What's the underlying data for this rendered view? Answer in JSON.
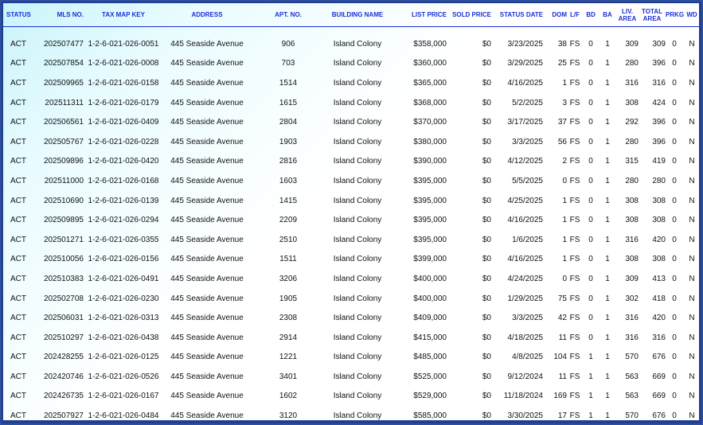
{
  "headers": {
    "status": "STATUS",
    "mls": "MLS NO.",
    "tmk": "TAX MAP KEY",
    "address": "ADDRESS",
    "apt": "APT. NO.",
    "building": "BUILDING NAME",
    "list_price": "LIST PRICE",
    "sold_price": "SOLD PRICE",
    "status_date": "STATUS DATE",
    "dom": "DOM",
    "lf": "L/F",
    "bd": "BD",
    "ba": "BA",
    "liv_area_1": "LIV.",
    "liv_area_2": "AREA",
    "total_area_1": "TOTAL",
    "total_area_2": "AREA",
    "prkg": "PRKG",
    "wd": "WD"
  },
  "rows": [
    {
      "status": "ACT",
      "mls": "202507477",
      "tmk": "1-2-6-021-026-0051",
      "address": "445 Seaside Avenue",
      "apt": "906",
      "building": "Island Colony",
      "list_price": "$358,000",
      "sold_price": "$0",
      "status_date": "3/23/2025",
      "dom": "38",
      "lf": "FS",
      "bd": "0",
      "ba": "1",
      "liv_area": "309",
      "total_area": "309",
      "prkg": "0",
      "wd": "N"
    },
    {
      "status": "ACT",
      "mls": "202507854",
      "tmk": "1-2-6-021-026-0008",
      "address": "445 Seaside Avenue",
      "apt": "703",
      "building": "Island Colony",
      "list_price": "$360,000",
      "sold_price": "$0",
      "status_date": "3/29/2025",
      "dom": "25",
      "lf": "FS",
      "bd": "0",
      "ba": "1",
      "liv_area": "280",
      "total_area": "396",
      "prkg": "0",
      "wd": "N"
    },
    {
      "status": "ACT",
      "mls": "202509965",
      "tmk": "1-2-6-021-026-0158",
      "address": "445 Seaside Avenue",
      "apt": "1514",
      "building": "Island Colony",
      "list_price": "$365,000",
      "sold_price": "$0",
      "status_date": "4/16/2025",
      "dom": "1",
      "lf": "FS",
      "bd": "0",
      "ba": "1",
      "liv_area": "316",
      "total_area": "316",
      "prkg": "0",
      "wd": "N"
    },
    {
      "status": "ACT",
      "mls": "202511311",
      "tmk": "1-2-6-021-026-0179",
      "address": "445 Seaside Avenue",
      "apt": "1615",
      "building": "Island Colony",
      "list_price": "$368,000",
      "sold_price": "$0",
      "status_date": "5/2/2025",
      "dom": "3",
      "lf": "FS",
      "bd": "0",
      "ba": "1",
      "liv_area": "308",
      "total_area": "424",
      "prkg": "0",
      "wd": "N"
    },
    {
      "status": "ACT",
      "mls": "202506561",
      "tmk": "1-2-6-021-026-0409",
      "address": "445 Seaside Avenue",
      "apt": "2804",
      "building": "Island Colony",
      "list_price": "$370,000",
      "sold_price": "$0",
      "status_date": "3/17/2025",
      "dom": "37",
      "lf": "FS",
      "bd": "0",
      "ba": "1",
      "liv_area": "292",
      "total_area": "396",
      "prkg": "0",
      "wd": "N"
    },
    {
      "status": "ACT",
      "mls": "202505767",
      "tmk": "1-2-6-021-026-0228",
      "address": "445 Seaside Avenue",
      "apt": "1903",
      "building": "Island Colony",
      "list_price": "$380,000",
      "sold_price": "$0",
      "status_date": "3/3/2025",
      "dom": "56",
      "lf": "FS",
      "bd": "0",
      "ba": "1",
      "liv_area": "280",
      "total_area": "396",
      "prkg": "0",
      "wd": "N"
    },
    {
      "status": "ACT",
      "mls": "202509896",
      "tmk": "1-2-6-021-026-0420",
      "address": "445 Seaside Avenue",
      "apt": "2816",
      "building": "Island Colony",
      "list_price": "$390,000",
      "sold_price": "$0",
      "status_date": "4/12/2025",
      "dom": "2",
      "lf": "FS",
      "bd": "0",
      "ba": "1",
      "liv_area": "315",
      "total_area": "419",
      "prkg": "0",
      "wd": "N"
    },
    {
      "status": "ACT",
      "mls": "202511000",
      "tmk": "1-2-6-021-026-0168",
      "address": "445 Seaside Avenue",
      "apt": "1603",
      "building": "Island Colony",
      "list_price": "$395,000",
      "sold_price": "$0",
      "status_date": "5/5/2025",
      "dom": "0",
      "lf": "FS",
      "bd": "0",
      "ba": "1",
      "liv_area": "280",
      "total_area": "280",
      "prkg": "0",
      "wd": "N"
    },
    {
      "status": "ACT",
      "mls": "202510690",
      "tmk": "1-2-6-021-026-0139",
      "address": "445 Seaside Avenue",
      "apt": "1415",
      "building": "Island Colony",
      "list_price": "$395,000",
      "sold_price": "$0",
      "status_date": "4/25/2025",
      "dom": "1",
      "lf": "FS",
      "bd": "0",
      "ba": "1",
      "liv_area": "308",
      "total_area": "308",
      "prkg": "0",
      "wd": "N"
    },
    {
      "status": "ACT",
      "mls": "202509895",
      "tmk": "1-2-6-021-026-0294",
      "address": "445 Seaside Avenue",
      "apt": "2209",
      "building": "Island Colony",
      "list_price": "$395,000",
      "sold_price": "$0",
      "status_date": "4/16/2025",
      "dom": "1",
      "lf": "FS",
      "bd": "0",
      "ba": "1",
      "liv_area": "308",
      "total_area": "308",
      "prkg": "0",
      "wd": "N"
    },
    {
      "status": "ACT",
      "mls": "202501271",
      "tmk": "1-2-6-021-026-0355",
      "address": "445 Seaside Avenue",
      "apt": "2510",
      "building": "Island Colony",
      "list_price": "$395,000",
      "sold_price": "$0",
      "status_date": "1/6/2025",
      "dom": "1",
      "lf": "FS",
      "bd": "0",
      "ba": "1",
      "liv_area": "316",
      "total_area": "420",
      "prkg": "0",
      "wd": "N"
    },
    {
      "status": "ACT",
      "mls": "202510056",
      "tmk": "1-2-6-021-026-0156",
      "address": "445 Seaside Avenue",
      "apt": "1511",
      "building": "Island Colony",
      "list_price": "$399,000",
      "sold_price": "$0",
      "status_date": "4/16/2025",
      "dom": "1",
      "lf": "FS",
      "bd": "0",
      "ba": "1",
      "liv_area": "308",
      "total_area": "308",
      "prkg": "0",
      "wd": "N"
    },
    {
      "status": "ACT",
      "mls": "202510383",
      "tmk": "1-2-6-021-026-0491",
      "address": "445 Seaside Avenue",
      "apt": "3206",
      "building": "Island Colony",
      "list_price": "$400,000",
      "sold_price": "$0",
      "status_date": "4/24/2025",
      "dom": "0",
      "lf": "FS",
      "bd": "0",
      "ba": "1",
      "liv_area": "309",
      "total_area": "413",
      "prkg": "0",
      "wd": "N"
    },
    {
      "status": "ACT",
      "mls": "202502708",
      "tmk": "1-2-6-021-026-0230",
      "address": "445 Seaside Avenue",
      "apt": "1905",
      "building": "Island Colony",
      "list_price": "$400,000",
      "sold_price": "$0",
      "status_date": "1/29/2025",
      "dom": "75",
      "lf": "FS",
      "bd": "0",
      "ba": "1",
      "liv_area": "302",
      "total_area": "418",
      "prkg": "0",
      "wd": "N"
    },
    {
      "status": "ACT",
      "mls": "202506031",
      "tmk": "1-2-6-021-026-0313",
      "address": "445 Seaside Avenue",
      "apt": "2308",
      "building": "Island Colony",
      "list_price": "$409,000",
      "sold_price": "$0",
      "status_date": "3/3/2025",
      "dom": "42",
      "lf": "FS",
      "bd": "0",
      "ba": "1",
      "liv_area": "316",
      "total_area": "420",
      "prkg": "0",
      "wd": "N"
    },
    {
      "status": "ACT",
      "mls": "202510297",
      "tmk": "1-2-6-021-026-0438",
      "address": "445 Seaside Avenue",
      "apt": "2914",
      "building": "Island Colony",
      "list_price": "$415,000",
      "sold_price": "$0",
      "status_date": "4/18/2025",
      "dom": "11",
      "lf": "FS",
      "bd": "0",
      "ba": "1",
      "liv_area": "316",
      "total_area": "316",
      "prkg": "0",
      "wd": "N"
    },
    {
      "status": "ACT",
      "mls": "202428255",
      "tmk": "1-2-6-021-026-0125",
      "address": "445 Seaside Avenue",
      "apt": "1221",
      "building": "Island Colony",
      "list_price": "$485,000",
      "sold_price": "$0",
      "status_date": "4/8/2025",
      "dom": "104",
      "lf": "FS",
      "bd": "1",
      "ba": "1",
      "liv_area": "570",
      "total_area": "676",
      "prkg": "0",
      "wd": "N"
    },
    {
      "status": "ACT",
      "mls": "202420746",
      "tmk": "1-2-6-021-026-0526",
      "address": "445 Seaside Avenue",
      "apt": "3401",
      "building": "Island Colony",
      "list_price": "$525,000",
      "sold_price": "$0",
      "status_date": "9/12/2024",
      "dom": "11",
      "lf": "FS",
      "bd": "1",
      "ba": "1",
      "liv_area": "563",
      "total_area": "669",
      "prkg": "0",
      "wd": "N"
    },
    {
      "status": "ACT",
      "mls": "202426735",
      "tmk": "1-2-6-021-026-0167",
      "address": "445 Seaside Avenue",
      "apt": "1602",
      "building": "Island Colony",
      "list_price": "$529,000",
      "sold_price": "$0",
      "status_date": "11/18/2024",
      "dom": "169",
      "lf": "FS",
      "bd": "1",
      "ba": "1",
      "liv_area": "563",
      "total_area": "669",
      "prkg": "0",
      "wd": "N"
    },
    {
      "status": "ACT",
      "mls": "202507927",
      "tmk": "1-2-6-021-026-0484",
      "address": "445 Seaside Avenue",
      "apt": "3120",
      "building": "Island Colony",
      "list_price": "$585,000",
      "sold_price": "$0",
      "status_date": "3/30/2025",
      "dom": "17",
      "lf": "FS",
      "bd": "1",
      "ba": "1",
      "liv_area": "570",
      "total_area": "676",
      "prkg": "0",
      "wd": "N"
    }
  ]
}
